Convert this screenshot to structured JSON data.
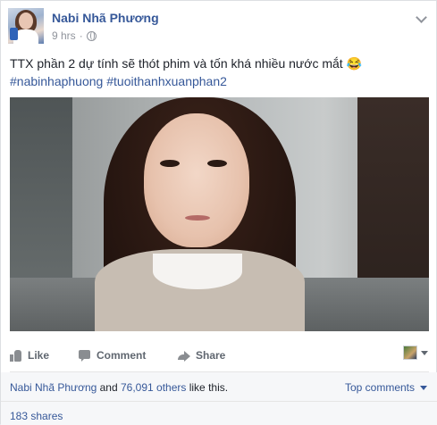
{
  "post": {
    "author": "Nabi Nhã Phương",
    "time": "9 hrs",
    "separator": "·",
    "text": "TTX phần 2 dự tính sẽ thót phim và tốn khá nhiều nước mắt 😂",
    "hashtags": [
      "#nabinhaphuong",
      "#tuoithanhxuanphan2"
    ]
  },
  "actions": {
    "like": "Like",
    "comment": "Comment",
    "share": "Share"
  },
  "reactions": {
    "first_name": "Nabi Nhã Phương",
    "and": " and ",
    "others": "76,091 others",
    "suffix": " like this.",
    "top_comments": "Top comments"
  },
  "shares": "183 shares",
  "icons": [
    "globe-icon",
    "chevron-down-icon",
    "like-icon",
    "comment-icon",
    "share-icon",
    "dropdown-triangle-icon"
  ],
  "colors": {
    "link": "#365899",
    "meta": "#90949c",
    "text": "#1d2129"
  }
}
